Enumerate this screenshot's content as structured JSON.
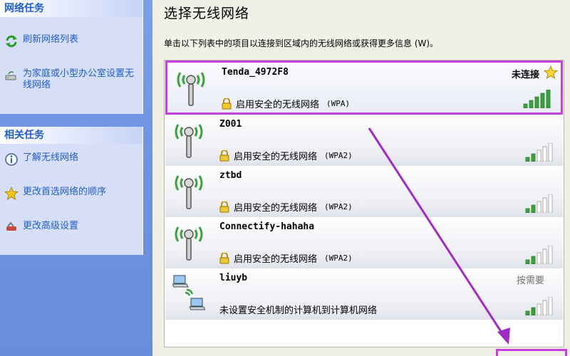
{
  "sidebar": {
    "network_tasks": {
      "title": "网络任务",
      "items": [
        {
          "label": "刷新网络列表",
          "icon": "refresh-icon"
        },
        {
          "label": "为家庭或小型办公室设置无线网络",
          "icon": "setup-network-icon"
        }
      ]
    },
    "related_tasks": {
      "title": "相关任务",
      "items": [
        {
          "label": "了解无线网络",
          "icon": "info-icon"
        },
        {
          "label": "更改首选网络的顺序",
          "icon": "star-icon"
        },
        {
          "label": "更改高级设置",
          "icon": "settings-icon"
        }
      ]
    }
  },
  "main": {
    "title": "选择无线网络",
    "description": "单击以下列表中的项目以连接到区域内的无线网络或获得更多信息 (W)。",
    "networks": [
      {
        "name": "Tenda_4972F8",
        "status": "未连接",
        "security": "启用安全的无线网络",
        "protocol": "(WPA)",
        "signal": 5,
        "type": "access-point"
      },
      {
        "name": "Z001",
        "status": "",
        "security": "启用安全的无线网络",
        "protocol": "(WPA2)",
        "signal": 2,
        "type": "access-point"
      },
      {
        "name": "ztbd",
        "status": "",
        "security": "启用安全的无线网络",
        "protocol": "(WPA2)",
        "signal": 2,
        "type": "access-point"
      },
      {
        "name": "Connectify-hahaha",
        "status": "",
        "security": "启用安全的无线网络",
        "protocol": "(WPA2)",
        "signal": 2,
        "type": "access-point"
      },
      {
        "name": "liuyb",
        "status": "按需要",
        "security": "未设置安全机制的计算机到计算机网络",
        "protocol": "",
        "signal": 2,
        "type": "ad-hoc"
      }
    ]
  },
  "colors": {
    "sidebar_bg": "#7b9ee6",
    "task_link": "#215dc6",
    "highlight": "#c83ee0",
    "signal_on": "#3aa23a"
  }
}
